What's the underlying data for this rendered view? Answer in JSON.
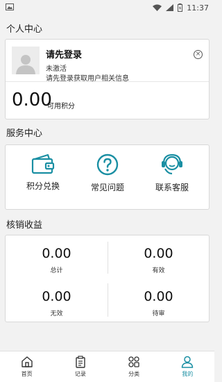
{
  "status_bar": {
    "time": "11:37"
  },
  "profile": {
    "section_title": "个人中心",
    "login_title": "请先登录",
    "status": "未激活",
    "hint": "请先登录获取用户相关信息",
    "points_value": "0.00",
    "points_label": "可用积分"
  },
  "services": {
    "section_title": "服务中心",
    "items": [
      {
        "label": "积分兑换",
        "icon": "wallet-icon"
      },
      {
        "label": "常见问题",
        "icon": "question-icon"
      },
      {
        "label": "联系客服",
        "icon": "headset-icon"
      }
    ]
  },
  "earnings": {
    "section_title": "核销收益",
    "stats": [
      {
        "value": "0.00",
        "label": "总计"
      },
      {
        "value": "0.00",
        "label": "有效"
      },
      {
        "value": "0.00",
        "label": "无效"
      },
      {
        "value": "0.00",
        "label": "待审"
      }
    ]
  },
  "tabbar": {
    "items": [
      {
        "label": "首页",
        "icon": "home-icon"
      },
      {
        "label": "记录",
        "icon": "clipboard-icon"
      },
      {
        "label": "分类",
        "icon": "grid-icon"
      },
      {
        "label": "我的",
        "icon": "person-icon"
      }
    ],
    "active_color": "#1a8fa3"
  },
  "colors": {
    "accent": "#1a8fa3",
    "background": "#f2f2f2"
  }
}
